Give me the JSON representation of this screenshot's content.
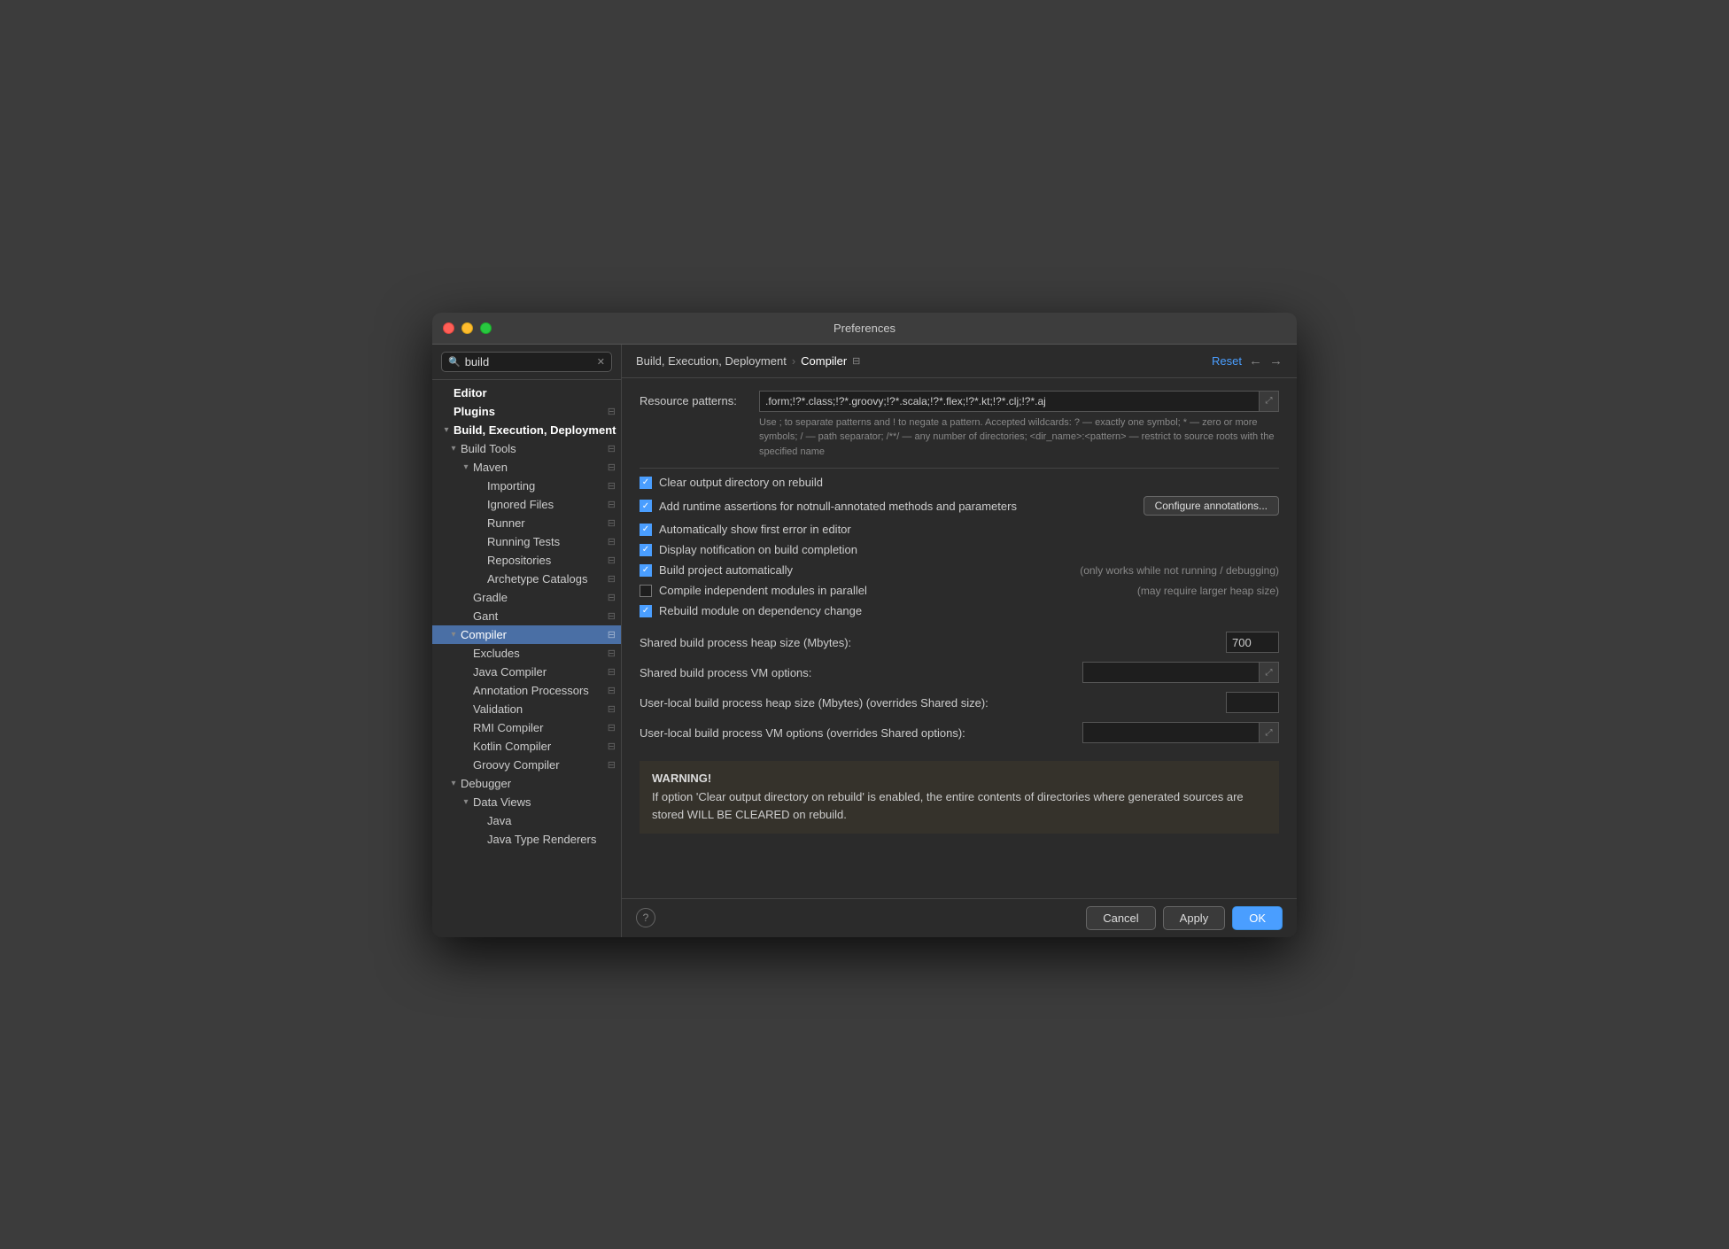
{
  "window": {
    "title": "Preferences"
  },
  "search": {
    "value": "build",
    "placeholder": "build"
  },
  "breadcrumb": {
    "parent": "Build, Execution, Deployment",
    "separator": "›",
    "current": "Compiler",
    "icon": "⊟"
  },
  "header": {
    "reset_label": "Reset",
    "back_label": "←",
    "forward_label": "→"
  },
  "sidebar": {
    "editor_label": "Editor",
    "plugins_label": "Plugins",
    "build_execution_label": "Build, Execution, Deployment",
    "build_tools_label": "Build Tools",
    "maven_label": "Maven",
    "importing_label": "Importing",
    "ignored_files_label": "Ignored Files",
    "runner_label": "Runner",
    "running_tests_label": "Running Tests",
    "repositories_label": "Repositories",
    "archetype_catalogs_label": "Archetype Catalogs",
    "gradle_label": "Gradle",
    "gant_label": "Gant",
    "compiler_label": "Compiler",
    "excludes_label": "Excludes",
    "java_compiler_label": "Java Compiler",
    "annotation_processors_label": "Annotation Processors",
    "validation_label": "Validation",
    "rmi_compiler_label": "RMI Compiler",
    "kotlin_compiler_label": "Kotlin Compiler",
    "groovy_compiler_label": "Groovy Compiler",
    "debugger_label": "Debugger",
    "data_views_label": "Data Views",
    "java_label": "Java",
    "java_type_renderers_label": "Java Type Renderers"
  },
  "resource_patterns": {
    "label": "Resource patterns:",
    "value": ".form;!?*.class;!?*.groovy;!?*.scala;!?*.flex;!?*.kt;!?*.clj;!?*.aj",
    "hint": "Use ; to separate patterns and ! to negate a pattern. Accepted wildcards: ? — exactly one symbol; * — zero or more symbols; / — path separator; /**/ — any number of directories; <dir_name>:<pattern> — restrict to source roots with the specified name"
  },
  "checkboxes": [
    {
      "id": "clear_output",
      "checked": true,
      "label": "Clear output directory on rebuild",
      "note": ""
    },
    {
      "id": "add_runtime",
      "checked": true,
      "label": "Add runtime assertions for notnull-annotated methods and parameters",
      "note": "",
      "has_configure": true
    },
    {
      "id": "auto_show",
      "checked": true,
      "label": "Automatically show first error in editor",
      "note": ""
    },
    {
      "id": "display_notification",
      "checked": true,
      "label": "Display notification on build completion",
      "note": ""
    },
    {
      "id": "build_auto",
      "checked": true,
      "label": "Build project automatically",
      "note": "(only works while not running / debugging)"
    },
    {
      "id": "compile_parallel",
      "checked": false,
      "label": "Compile independent modules in parallel",
      "note": "(may require larger heap size)"
    },
    {
      "id": "rebuild_module",
      "checked": true,
      "label": "Rebuild module on dependency change",
      "note": ""
    }
  ],
  "configure_annotations_label": "Configure annotations...",
  "shared_heap": {
    "label": "Shared build process heap size (Mbytes):",
    "value": "700"
  },
  "shared_vm": {
    "label": "Shared build process VM options:",
    "value": ""
  },
  "user_heap": {
    "label": "User-local build process heap size (Mbytes) (overrides Shared size):",
    "value": ""
  },
  "user_vm": {
    "label": "User-local build process VM options (overrides Shared options):",
    "value": ""
  },
  "warning": {
    "title": "WARNING!",
    "text": "If option 'Clear output directory on rebuild' is enabled, the entire contents of directories where generated sources are stored WILL BE CLEARED on rebuild."
  },
  "footer": {
    "help_label": "?",
    "cancel_label": "Cancel",
    "apply_label": "Apply",
    "ok_label": "OK"
  }
}
